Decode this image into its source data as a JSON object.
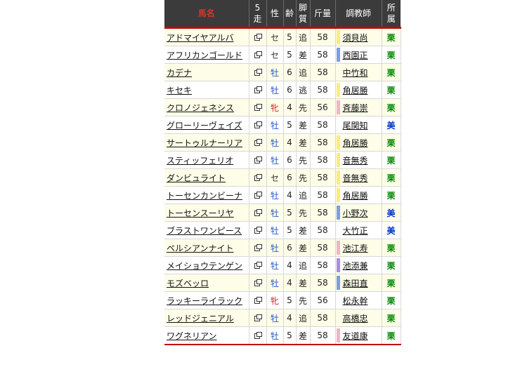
{
  "header": {
    "name": "馬名",
    "five": "5走",
    "sex": "性",
    "age": "齢",
    "style": "脚質",
    "weight": "斤量",
    "trainer": "調教師",
    "stable": "所属"
  },
  "colors": {
    "sex_male": "#2255cc",
    "sex_female": "#cc2222",
    "sex_gelding": "#333333",
    "stable_ritto": "#008800",
    "stable_miho": "#0033cc"
  },
  "rows": [
    {
      "name": "アドマイヤアルバ",
      "sex": "セ",
      "age": "5",
      "style": "追",
      "weight": "58",
      "trainer": "須貝尚",
      "stable": "栗",
      "mark": "#f7ef77"
    },
    {
      "name": "アフリカンゴールド",
      "sex": "セ",
      "age": "5",
      "style": "差",
      "weight": "58",
      "trainer": "西園正",
      "stable": "栗",
      "mark": "#7a9ee8"
    },
    {
      "name": "カデナ",
      "sex": "牡",
      "age": "6",
      "style": "追",
      "weight": "58",
      "trainer": "中竹和",
      "stable": "栗",
      "mark": ""
    },
    {
      "name": "キセキ",
      "sex": "牡",
      "age": "6",
      "style": "逃",
      "weight": "58",
      "trainer": "角居勝",
      "stable": "栗",
      "mark": "#f7ef77"
    },
    {
      "name": "クロノジェネシス",
      "sex": "牝",
      "age": "4",
      "style": "先",
      "weight": "56",
      "trainer": "斉藤崇",
      "stable": "栗",
      "mark": "#f4b4c4"
    },
    {
      "name": "グローリーヴェイズ",
      "sex": "牡",
      "age": "5",
      "style": "差",
      "weight": "58",
      "trainer": "尾関知",
      "stable": "美",
      "mark": ""
    },
    {
      "name": "サートゥルナーリア",
      "sex": "牡",
      "age": "4",
      "style": "差",
      "weight": "58",
      "trainer": "角居勝",
      "stable": "栗",
      "mark": "#f7ef77"
    },
    {
      "name": "スティッフェリオ",
      "sex": "牡",
      "age": "6",
      "style": "先",
      "weight": "58",
      "trainer": "音無秀",
      "stable": "栗",
      "mark": "#f7ef77"
    },
    {
      "name": "ダンビュライト",
      "sex": "セ",
      "age": "6",
      "style": "先",
      "weight": "58",
      "trainer": "音無秀",
      "stable": "栗",
      "mark": "#f7ef77"
    },
    {
      "name": "トーセンカンビーナ",
      "sex": "牡",
      "age": "4",
      "style": "追",
      "weight": "58",
      "trainer": "角居勝",
      "stable": "栗",
      "mark": "#f7ef77"
    },
    {
      "name": "トーセンスーリヤ",
      "sex": "牡",
      "age": "5",
      "style": "先",
      "weight": "58",
      "trainer": "小野次",
      "stable": "美",
      "mark": "#7a9ee8"
    },
    {
      "name": "ブラストワンピース",
      "sex": "牡",
      "age": "5",
      "style": "差",
      "weight": "58",
      "trainer": "大竹正",
      "stable": "美",
      "mark": ""
    },
    {
      "name": "ペルシアンナイト",
      "sex": "牡",
      "age": "6",
      "style": "差",
      "weight": "58",
      "trainer": "池江寿",
      "stable": "栗",
      "mark": "#f4b4c4"
    },
    {
      "name": "メイショウテンゲン",
      "sex": "牡",
      "age": "4",
      "style": "追",
      "weight": "58",
      "trainer": "池添兼",
      "stable": "栗",
      "mark": "#a88ee0"
    },
    {
      "name": "モズベッロ",
      "sex": "牡",
      "age": "4",
      "style": "差",
      "weight": "58",
      "trainer": "森田直",
      "stable": "栗",
      "mark": "#7a9ee8"
    },
    {
      "name": "ラッキーライラック",
      "sex": "牝",
      "age": "5",
      "style": "先",
      "weight": "56",
      "trainer": "松永幹",
      "stable": "栗",
      "mark": ""
    },
    {
      "name": "レッドジェニアル",
      "sex": "牡",
      "age": "4",
      "style": "追",
      "weight": "58",
      "trainer": "高橋忠",
      "stable": "栗",
      "mark": ""
    },
    {
      "name": "ワグネリアン",
      "sex": "牡",
      "age": "5",
      "style": "差",
      "weight": "58",
      "trainer": "友道康",
      "stable": "栗",
      "mark": "#f4b4c4"
    }
  ]
}
